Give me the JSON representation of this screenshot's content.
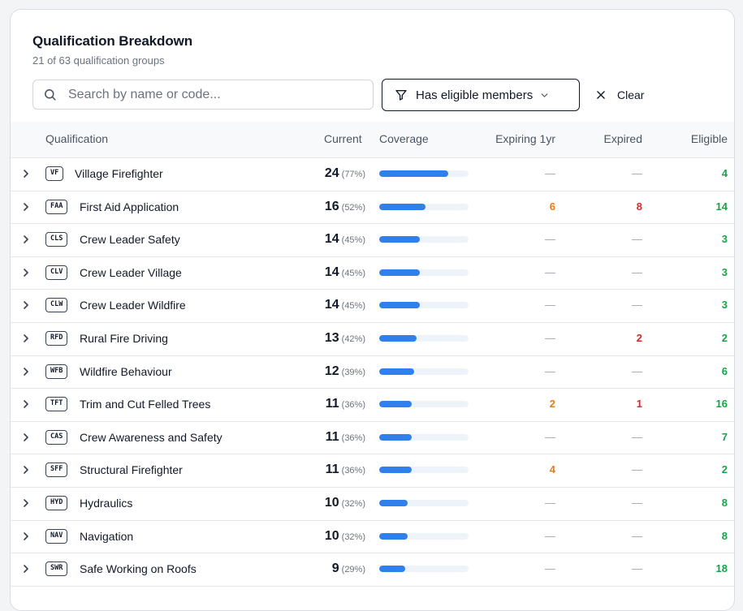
{
  "header": {
    "title": "Qualification Breakdown",
    "subtitle": "21 of 63 qualification groups"
  },
  "search": {
    "placeholder": "Search by name or code...",
    "value": ""
  },
  "filter": {
    "label": "Has eligible members"
  },
  "clear": {
    "label": "Clear"
  },
  "columns": {
    "qualification": "Qualification",
    "current": "Current",
    "coverage": "Coverage",
    "expiring": "Expiring 1yr",
    "expired": "Expired",
    "eligible": "Eligible"
  },
  "colors": {
    "accent": "#2f80ed",
    "orange": "#ea7a17",
    "red": "#dc2626",
    "green": "#16a34a"
  },
  "rows": [
    {
      "code": "VF",
      "name": "Village Firefighter",
      "current": "24",
      "pct": "(77%)",
      "coverage": 0.77,
      "expiring": "—",
      "expired": "—",
      "eligible": "4"
    },
    {
      "code": "FAA",
      "name": "First Aid Application",
      "current": "16",
      "pct": "(52%)",
      "coverage": 0.52,
      "expiring": "6",
      "expired": "8",
      "eligible": "14"
    },
    {
      "code": "CLS",
      "name": "Crew Leader Safety",
      "current": "14",
      "pct": "(45%)",
      "coverage": 0.45,
      "expiring": "—",
      "expired": "—",
      "eligible": "3"
    },
    {
      "code": "CLV",
      "name": "Crew Leader Village",
      "current": "14",
      "pct": "(45%)",
      "coverage": 0.45,
      "expiring": "—",
      "expired": "—",
      "eligible": "3"
    },
    {
      "code": "CLW",
      "name": "Crew Leader Wildfire",
      "current": "14",
      "pct": "(45%)",
      "coverage": 0.45,
      "expiring": "—",
      "expired": "—",
      "eligible": "3"
    },
    {
      "code": "RFD",
      "name": "Rural Fire Driving",
      "current": "13",
      "pct": "(42%)",
      "coverage": 0.42,
      "expiring": "—",
      "expired": "2",
      "eligible": "2"
    },
    {
      "code": "WFB",
      "name": "Wildfire Behaviour",
      "current": "12",
      "pct": "(39%)",
      "coverage": 0.39,
      "expiring": "—",
      "expired": "—",
      "eligible": "6"
    },
    {
      "code": "TFT",
      "name": "Trim and Cut Felled Trees",
      "current": "11",
      "pct": "(36%)",
      "coverage": 0.36,
      "expiring": "2",
      "expired": "1",
      "eligible": "16"
    },
    {
      "code": "CAS",
      "name": "Crew Awareness and Safety",
      "current": "11",
      "pct": "(36%)",
      "coverage": 0.36,
      "expiring": "—",
      "expired": "—",
      "eligible": "7"
    },
    {
      "code": "SFF",
      "name": "Structural Firefighter",
      "current": "11",
      "pct": "(36%)",
      "coverage": 0.36,
      "expiring": "4",
      "expired": "—",
      "eligible": "2"
    },
    {
      "code": "HYD",
      "name": "Hydraulics",
      "current": "10",
      "pct": "(32%)",
      "coverage": 0.32,
      "expiring": "—",
      "expired": "—",
      "eligible": "8"
    },
    {
      "code": "NAV",
      "name": "Navigation",
      "current": "10",
      "pct": "(32%)",
      "coverage": 0.32,
      "expiring": "—",
      "expired": "—",
      "eligible": "8"
    },
    {
      "code": "SWR",
      "name": "Safe Working on Roofs",
      "current": "9",
      "pct": "(29%)",
      "coverage": 0.29,
      "expiring": "—",
      "expired": "—",
      "eligible": "18"
    }
  ]
}
